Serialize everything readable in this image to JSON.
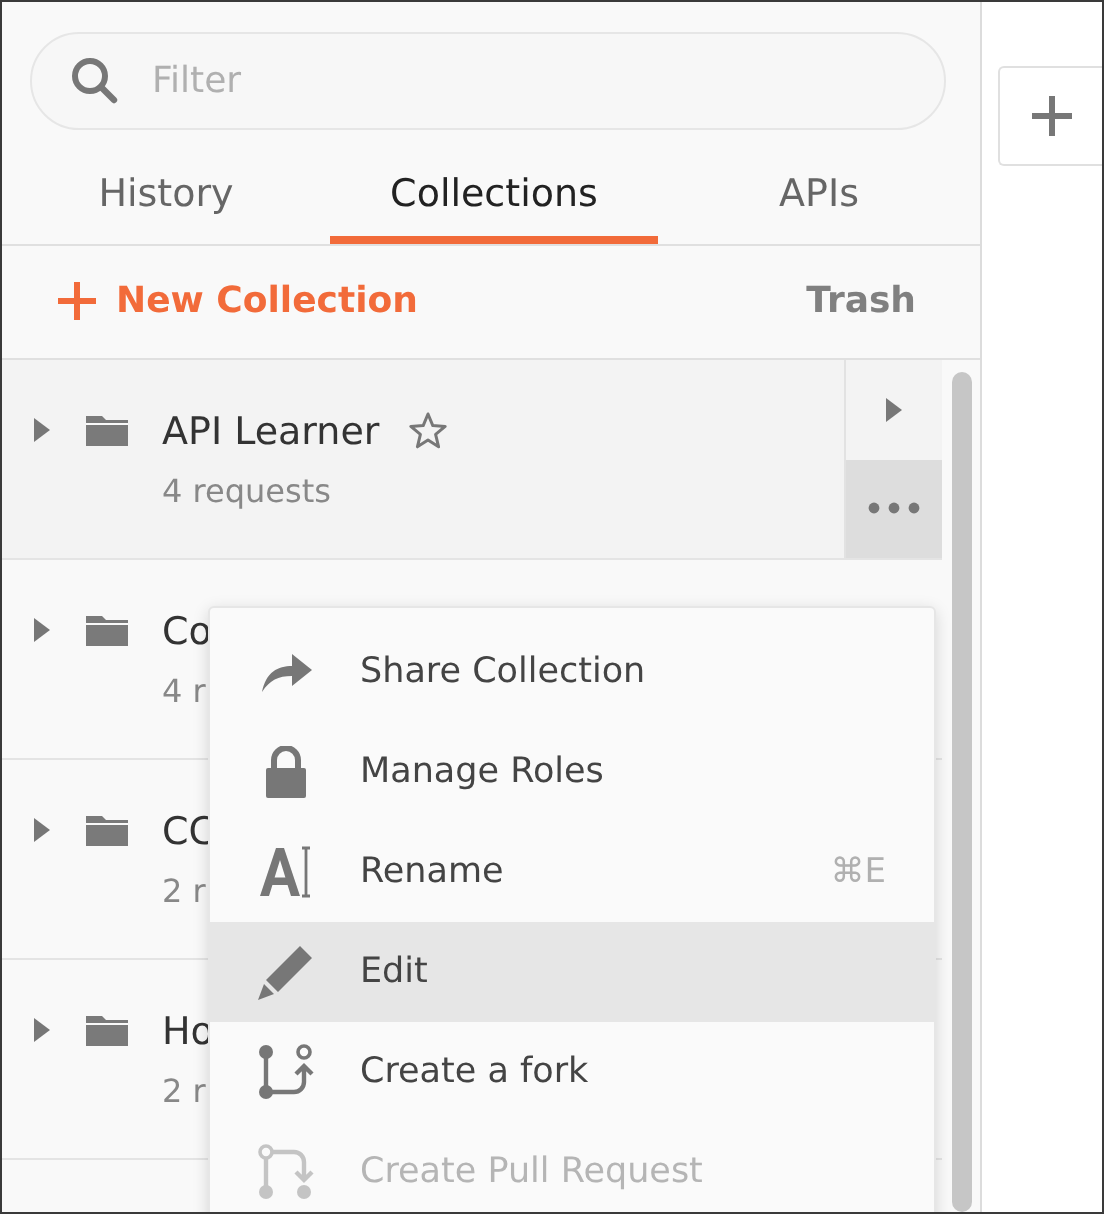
{
  "search": {
    "placeholder": "Filter"
  },
  "tabs": [
    {
      "label": "History",
      "selected": false
    },
    {
      "label": "Collections",
      "selected": true
    },
    {
      "label": "APIs",
      "selected": false
    }
  ],
  "new_collection": "New Collection",
  "trash": "Trash",
  "collections": [
    {
      "name": "API Learner",
      "count": "4 requests",
      "selected": true
    },
    {
      "name": "Co",
      "count": "4 r",
      "selected": false
    },
    {
      "name": "CC",
      "count": "2 r",
      "selected": false
    },
    {
      "name": "Ho",
      "count": "2 r",
      "selected": false
    }
  ],
  "menu": {
    "items": [
      {
        "label": "Share Collection",
        "selected": false,
        "disabled": false
      },
      {
        "label": "Manage Roles",
        "selected": false,
        "disabled": false
      },
      {
        "label": "Rename",
        "shortcut": "⌘E",
        "selected": false,
        "disabled": false
      },
      {
        "label": "Edit",
        "selected": true,
        "disabled": false
      },
      {
        "label": "Create a fork",
        "selected": false,
        "disabled": false
      },
      {
        "label": "Create Pull Request",
        "selected": false,
        "disabled": true
      }
    ]
  }
}
